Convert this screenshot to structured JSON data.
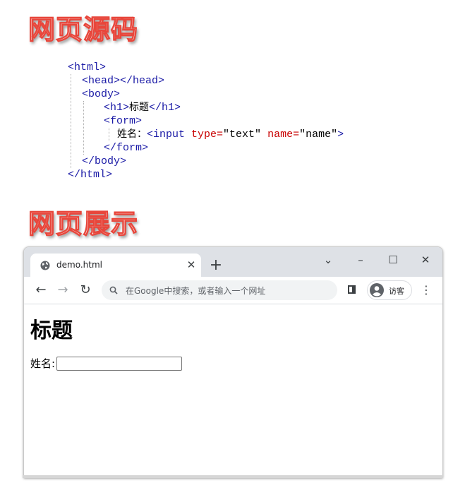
{
  "headings": {
    "source": "网页源码",
    "display": "网页展示"
  },
  "code": {
    "html_open": "<html>",
    "head": "<head></head>",
    "body_open": "<body>",
    "h1_open": "<h1>",
    "h1_text": "标题",
    "h1_close": "</h1>",
    "form_open": "<form>",
    "label_text": "姓名：",
    "input_tag": "<input",
    "type_attr": "type=",
    "type_val": "\"text\"",
    "name_attr": "name=",
    "name_val": "\"name\"",
    "input_end": ">",
    "form_close": "</form>",
    "body_close": "</body>",
    "html_close": "</html>"
  },
  "browser": {
    "tab_title": "demo.html",
    "tab_close": "✕",
    "new_tab": "+",
    "tab_search": "⌄",
    "minimize": "–",
    "maximize": "☐",
    "close": "✕",
    "back": "←",
    "forward": "→",
    "reload": "↻",
    "omnibox_placeholder": "在Google中搜索，或者输入一个网址",
    "profile_label": "访客",
    "menu": "⋮"
  },
  "page": {
    "h1": "标题",
    "label": "姓名:",
    "input_value": ""
  },
  "colors": {
    "heading_stroke": "#e8463b",
    "tag": "#1a1aa6",
    "attr": "#c80000",
    "tabstrip": "#dee1e6"
  }
}
